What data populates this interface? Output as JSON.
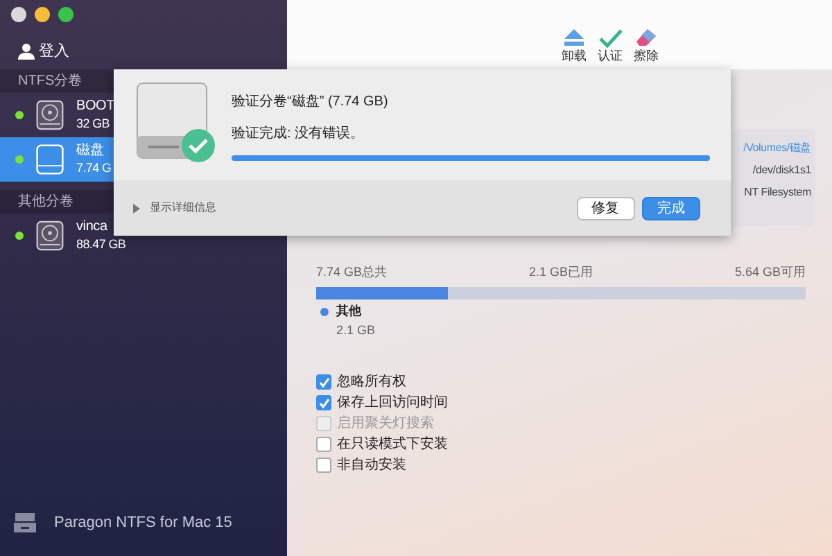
{
  "sidebar": {
    "login": "登入",
    "sections": [
      {
        "title": "NTFS分卷",
        "volumes": [
          {
            "name": "BOOT",
            "size": "32 GB",
            "selected": false
          },
          {
            "name": "磁盘",
            "size": "7.74 G",
            "selected": true
          }
        ]
      },
      {
        "title": "其他分卷",
        "volumes": [
          {
            "name": "vinca",
            "size": "88.47 GB",
            "selected": false
          }
        ]
      }
    ],
    "footer": "Paragon NTFS for Mac 15"
  },
  "toolbar": [
    {
      "kind": "eject",
      "label": "卸载"
    },
    {
      "kind": "verify",
      "label": "认证"
    },
    {
      "kind": "erase",
      "label": "擦除"
    }
  ],
  "info": [
    {
      "kind": "link",
      "text": "/Volumes/磁盘"
    },
    {
      "kind": "plain",
      "text": "/dev/disk1s1"
    },
    {
      "kind": "plain",
      "text": "NT Filesystem"
    }
  ],
  "usage": {
    "total": "7.74 GB总共",
    "used": "2.1 GB已用",
    "free": "5.64 GB可用",
    "level": 0.27,
    "legend": [
      {
        "name": "其他",
        "size": "2.1 GB",
        "color": "#4a86e0"
      }
    ]
  },
  "options": [
    {
      "label": "忽略所有权",
      "checked": true,
      "disabled": false
    },
    {
      "label": "保存上回访问时间",
      "checked": true,
      "disabled": false
    },
    {
      "label": "启用聚关灯搜索",
      "checked": false,
      "disabled": true
    },
    {
      "label": "在只读模式下安装",
      "checked": false,
      "disabled": false
    },
    {
      "label": "非自动安装",
      "checked": false,
      "disabled": false
    }
  ],
  "dialog": {
    "title": "验证分卷“磁盘” (7.74 GB)",
    "message": "验证完成: 没有错误。",
    "level": 1,
    "details": "显示详细信息",
    "buttons": [
      {
        "kind": "default",
        "label": "修复"
      },
      {
        "kind": "primary",
        "label": "完成"
      }
    ]
  }
}
